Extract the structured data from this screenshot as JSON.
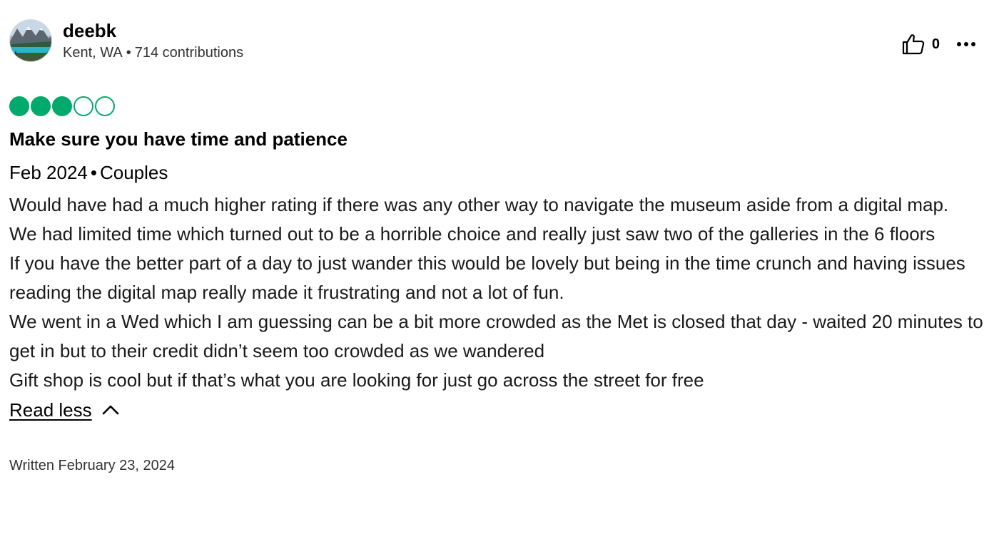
{
  "user": {
    "name": "deebk",
    "location": "Kent, WA",
    "separator": "•",
    "contributions": "714 contributions",
    "avatar_icon": "mountain-lake-photo"
  },
  "actions": {
    "helpful_icon": "thumbs-up-icon",
    "helpful_count": "0",
    "more_icon": "more-options-icon"
  },
  "rating": {
    "value": 3,
    "max": 5,
    "color": "#00AA6C"
  },
  "review": {
    "title": "Make sure you have time and patience",
    "date": "Feb 2024",
    "separator": "•",
    "trip_type": "Couples",
    "paragraphs": [
      "Would have had a much higher rating if there was any other way to navigate the museum aside from a digital map.",
      "We had limited time which turned out to be a horrible choice and really just saw two of the galleries in the 6 floors",
      "If you have the better part of a day to just wander this would be lovely but being in the time crunch and having issues reading the digital map really made it frustrating and not a lot of fun.",
      "We went in a Wed which I am guessing can be a bit more crowded as the Met is closed that day - waited 20 minutes to get in but to their credit didn’t seem too crowded as we wandered",
      "Gift shop is cool but if that’s what you are looking for just go across the street for free"
    ],
    "read_less_label": "Read less",
    "read_less_icon": "chevron-up-icon",
    "written_date": "Written February 23, 2024"
  }
}
